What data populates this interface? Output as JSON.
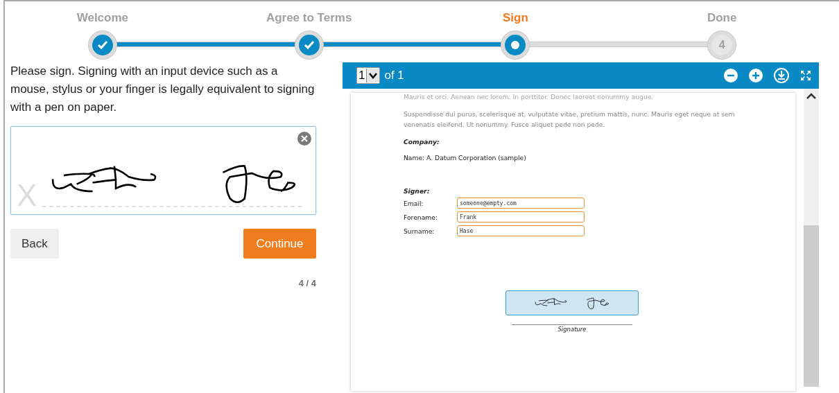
{
  "steps": [
    {
      "label": "Welcome",
      "completed": true,
      "current": false
    },
    {
      "label": "Agree to Terms",
      "completed": true,
      "current": false
    },
    {
      "label": "Sign",
      "completed": false,
      "current": true
    },
    {
      "label": "Done",
      "completed": false,
      "current": false,
      "number": "4"
    }
  ],
  "instructions": "Please sign. Signing with an input device such as a mouse, stylus or your finger is legally equivalent to signing with a pen on paper.",
  "signature_pad": {
    "marker": "X",
    "signed": true
  },
  "buttons": {
    "back": "Back",
    "continue": "Continue"
  },
  "progress": "4 / 4",
  "viewer": {
    "page": "1",
    "of": "of 1"
  },
  "document": {
    "faded_line": "Mauris et orci. Aenean nec lorem. In porttitor. Donec laoreet nonummy augue.",
    "paragraph": "Suspendisse dui purus, scelerisque at, vulputate vitae, pretium mattis, nunc. Mauris eget neque at sem venenatis eleifend. Ut nonummy. Fusce aliquet pede non pede.",
    "company_heading": "Company:",
    "company_name": "Name: A. Datum Corporation (sample)",
    "signer_heading": "Signer:",
    "fields": [
      {
        "label": "Email:",
        "value": "someone@empty.com"
      },
      {
        "label": "Forename:",
        "value": "Frank"
      },
      {
        "label": "Surname:",
        "value": "Hase"
      }
    ],
    "signature_caption": "Signature"
  }
}
